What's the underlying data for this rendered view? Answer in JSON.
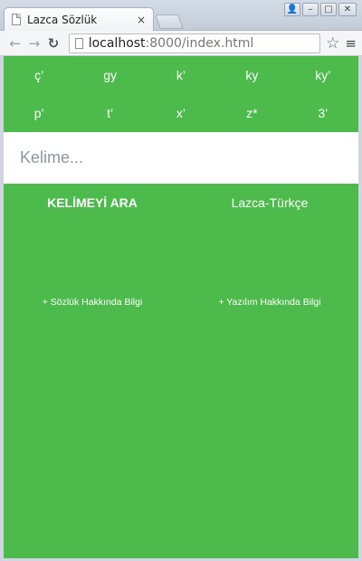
{
  "browser": {
    "tab_title": "Lazca Sözlük",
    "tab_close": "×",
    "url_host": "localhost",
    "url_rest": ":8000/index.html",
    "back": "←",
    "forward": "→",
    "reload": "↻",
    "star": "☆",
    "menu": "≡",
    "window_buttons": [
      "👤",
      "–",
      "□",
      "✕"
    ]
  },
  "keyboard": {
    "row1": [
      "ç’",
      "gy",
      "k’",
      "ky",
      "ky’"
    ],
    "row2": [
      "p’",
      "t’",
      "x’",
      "z*",
      "3’"
    ]
  },
  "search": {
    "placeholder": "Kelime..."
  },
  "actions": {
    "search_label": "KELİMEYİ ARA",
    "direction_label": "Lazca-Türkçe"
  },
  "info": {
    "dictionary_label": "+ Sözlük Hakkında Bilgi",
    "software_label": "+ Yazılım Hakkında Bilgi"
  },
  "colors": {
    "app_background": "#4cbb4c",
    "text": "#ffffff"
  }
}
